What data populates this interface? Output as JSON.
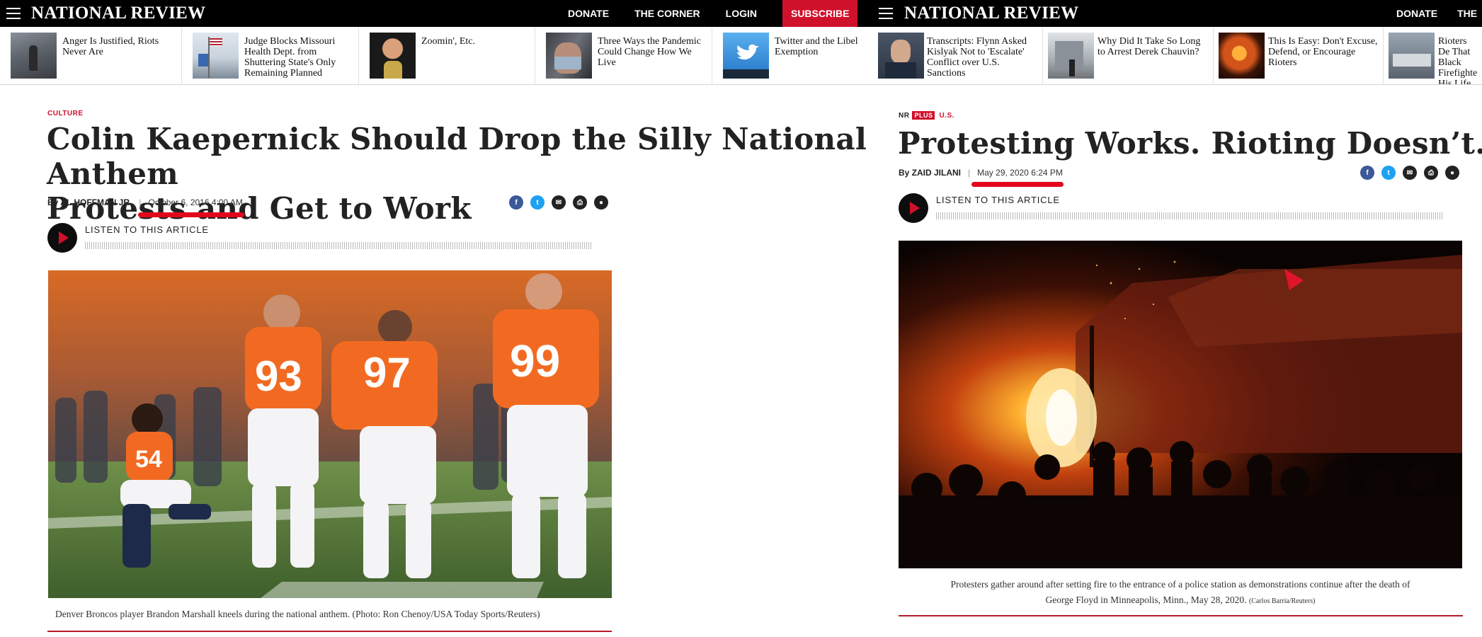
{
  "left": {
    "brand": "NATIONAL REVIEW",
    "nav": {
      "donate": "DONATE",
      "corner": "THE CORNER",
      "login": "LOGIN",
      "subscribe": "SUBSCRIBE"
    },
    "trending": [
      {
        "title": "Anger Is Justified, Riots Never Are"
      },
      {
        "title": "Judge Blocks Missouri Health Dept. from Shuttering State's Only Remaining Planned"
      },
      {
        "title": "Zoomin', Etc."
      },
      {
        "title": "Three Ways the Pandemic Could Change How We Live"
      },
      {
        "title": "Twitter and the Libel Exemption"
      }
    ],
    "article": {
      "kicker": "CULTURE",
      "headline_line1": "Colin Kaepernick Should Drop the Silly National Anthem",
      "headline_line2": "Protests and Get to Work",
      "author": "By AL HOFFMAN JR.",
      "separator": "|",
      "date": "October 6, 2016 4:00 AM",
      "listen_label": "LISTEN TO THIS ARTICLE",
      "caption": "Denver Broncos player Brandon Marshall kneels during the national anthem. (Photo: Ron Chenoy/USA Today Sports/Reuters)",
      "jersey_numbers": [
        "54",
        "93",
        "97",
        "99"
      ]
    }
  },
  "right": {
    "brand": "NATIONAL REVIEW",
    "nav": {
      "donate": "DONATE",
      "corner": "THE"
    },
    "trending": [
      {
        "title": "Transcripts: Flynn Asked Kislyak Not to 'Escalate' Conflict over U.S. Sanctions"
      },
      {
        "title": "Why Did It Take So Long to Arrest Derek Chauvin?"
      },
      {
        "title": "This Is Easy: Don't Excuse, Defend, or Encourage Rioters"
      },
      {
        "title": "Rioters De That Black Firefighte His Life Sa"
      }
    ],
    "article": {
      "kicker_nr": "NR",
      "kicker_plus": "PLUS",
      "kicker_section": "U.S.",
      "headline": "Protesting Works. Rioting Doesn’t.",
      "author": "By ZAID JILANI",
      "separator": "|",
      "date": "May 29, 2020 6:24 PM",
      "listen_label": "LISTEN TO THIS ARTICLE",
      "caption_line1": "Protesters gather around after setting fire to the entrance of a police station as demonstrations continue after the death of",
      "caption_line2": "George Floyd in Minneapolis, Minn., May 28, 2020.",
      "caption_credit": "(Carlos Barria/Reuters)"
    }
  },
  "share_icons": [
    "facebook-icon",
    "twitter-icon",
    "email-icon",
    "print-icon",
    "comment-icon"
  ],
  "colors": {
    "brand_red": "#d0112b",
    "annotation_red": "#e3061c",
    "topbar": "#000000",
    "facebook": "#3b5998",
    "twitter": "#1da1f2",
    "email": "#222222",
    "print": "#222222",
    "comment": "#222222"
  }
}
